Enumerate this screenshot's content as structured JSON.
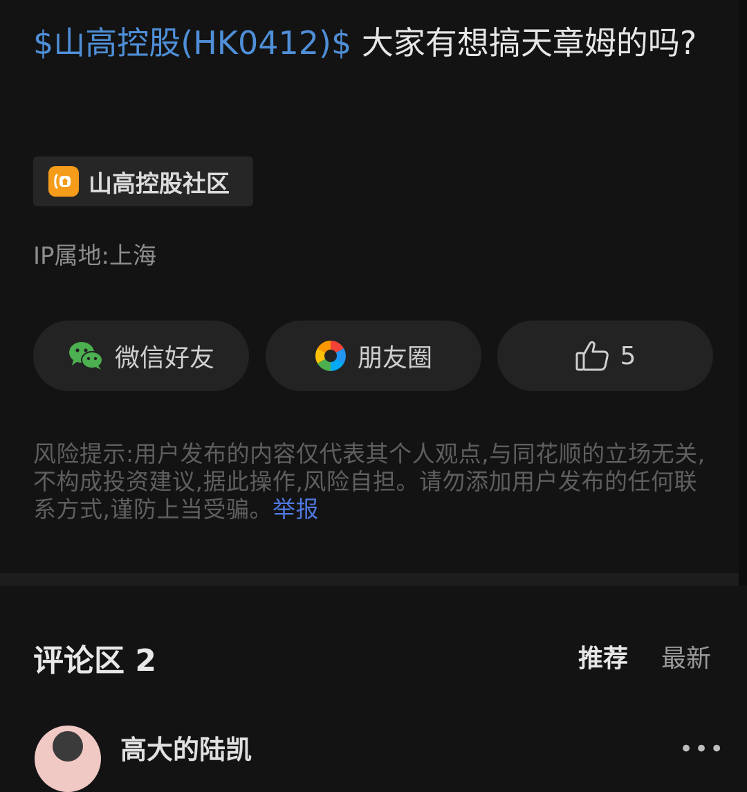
{
  "post": {
    "stock_tag": "$山高控股(HK0412)$",
    "text": " 大家有想搞天章姆的吗?"
  },
  "community": {
    "label": "山高控股社区",
    "icon": "community-house-icon",
    "icon_color": "#f59c1a"
  },
  "ip_location": "IP属地:上海",
  "share": {
    "wechat_label": "微信好友",
    "moments_label": "朋友圈",
    "like_count": "5"
  },
  "risk": {
    "text": "风险提示:用户发布的内容仅代表其个人观点,与同花顺的立场无关,不构成投资建议,据此操作,风险自担。请勿添加用户发布的任何联系方式,谨防上当受骗。",
    "report_label": "举报"
  },
  "comments": {
    "title": "评论区 2",
    "sort_recommend": "推荐",
    "sort_latest": "最新",
    "first_author": "高大的陆凯"
  },
  "colors": {
    "background": "#131313",
    "stock_link": "#4f8fd8",
    "report_link": "#4f78e0"
  }
}
